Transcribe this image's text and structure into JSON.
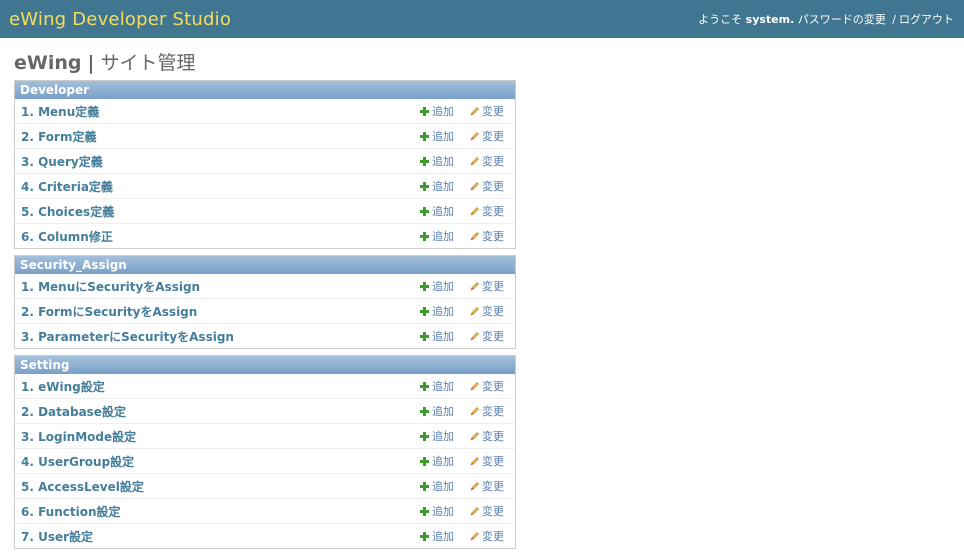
{
  "header": {
    "brand": "eWing Developer Studio",
    "welcome": "ようこそ",
    "username": "system.",
    "change_password": "パスワードの変更",
    "separator": "/",
    "logout": "ログアウト"
  },
  "page": {
    "title_brand": "eWing",
    "title_sep": "|",
    "title_text": "サイト管理"
  },
  "actions": {
    "add_label": "追加",
    "change_label": "変更",
    "add_icon": "plus-icon",
    "change_icon": "pencil-icon"
  },
  "colors": {
    "header_bg": "#417690",
    "brand_text": "#f5dd5d",
    "caption_bg": "#7ca0c7",
    "link": "#447e9b"
  },
  "modules": [
    {
      "caption": "Developer",
      "items": [
        "1. Menu定義",
        "2. Form定義",
        "3. Query定義",
        "4. Criteria定義",
        "5. Choices定義",
        "6. Column修正"
      ]
    },
    {
      "caption": "Security_Assign",
      "items": [
        "1. MenuにSecurityをAssign",
        "2. FormにSecurityをAssign",
        "3. ParameterにSecurityをAssign"
      ]
    },
    {
      "caption": "Setting",
      "items": [
        "1. eWing設定",
        "2. Database設定",
        "3. LoginMode設定",
        "4. UserGroup設定",
        "5. AccessLevel設定",
        "6. Function設定",
        "7. User設定"
      ]
    }
  ]
}
